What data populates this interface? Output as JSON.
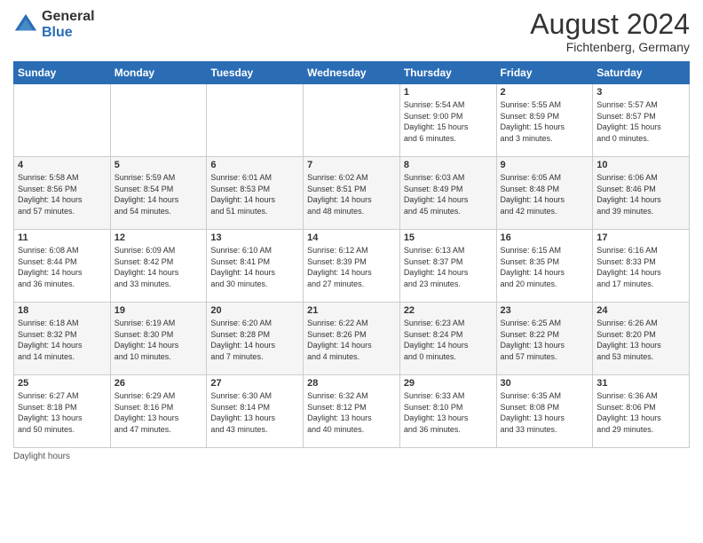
{
  "logo": {
    "general": "General",
    "blue": "Blue"
  },
  "title": {
    "month_year": "August 2024",
    "location": "Fichtenberg, Germany"
  },
  "days_of_week": [
    "Sunday",
    "Monday",
    "Tuesday",
    "Wednesday",
    "Thursday",
    "Friday",
    "Saturday"
  ],
  "weeks": [
    [
      {
        "day": "",
        "info": ""
      },
      {
        "day": "",
        "info": ""
      },
      {
        "day": "",
        "info": ""
      },
      {
        "day": "",
        "info": ""
      },
      {
        "day": "1",
        "info": "Sunrise: 5:54 AM\nSunset: 9:00 PM\nDaylight: 15 hours\nand 6 minutes."
      },
      {
        "day": "2",
        "info": "Sunrise: 5:55 AM\nSunset: 8:59 PM\nDaylight: 15 hours\nand 3 minutes."
      },
      {
        "day": "3",
        "info": "Sunrise: 5:57 AM\nSunset: 8:57 PM\nDaylight: 15 hours\nand 0 minutes."
      }
    ],
    [
      {
        "day": "4",
        "info": "Sunrise: 5:58 AM\nSunset: 8:56 PM\nDaylight: 14 hours\nand 57 minutes."
      },
      {
        "day": "5",
        "info": "Sunrise: 5:59 AM\nSunset: 8:54 PM\nDaylight: 14 hours\nand 54 minutes."
      },
      {
        "day": "6",
        "info": "Sunrise: 6:01 AM\nSunset: 8:53 PM\nDaylight: 14 hours\nand 51 minutes."
      },
      {
        "day": "7",
        "info": "Sunrise: 6:02 AM\nSunset: 8:51 PM\nDaylight: 14 hours\nand 48 minutes."
      },
      {
        "day": "8",
        "info": "Sunrise: 6:03 AM\nSunset: 8:49 PM\nDaylight: 14 hours\nand 45 minutes."
      },
      {
        "day": "9",
        "info": "Sunrise: 6:05 AM\nSunset: 8:48 PM\nDaylight: 14 hours\nand 42 minutes."
      },
      {
        "day": "10",
        "info": "Sunrise: 6:06 AM\nSunset: 8:46 PM\nDaylight: 14 hours\nand 39 minutes."
      }
    ],
    [
      {
        "day": "11",
        "info": "Sunrise: 6:08 AM\nSunset: 8:44 PM\nDaylight: 14 hours\nand 36 minutes."
      },
      {
        "day": "12",
        "info": "Sunrise: 6:09 AM\nSunset: 8:42 PM\nDaylight: 14 hours\nand 33 minutes."
      },
      {
        "day": "13",
        "info": "Sunrise: 6:10 AM\nSunset: 8:41 PM\nDaylight: 14 hours\nand 30 minutes."
      },
      {
        "day": "14",
        "info": "Sunrise: 6:12 AM\nSunset: 8:39 PM\nDaylight: 14 hours\nand 27 minutes."
      },
      {
        "day": "15",
        "info": "Sunrise: 6:13 AM\nSunset: 8:37 PM\nDaylight: 14 hours\nand 23 minutes."
      },
      {
        "day": "16",
        "info": "Sunrise: 6:15 AM\nSunset: 8:35 PM\nDaylight: 14 hours\nand 20 minutes."
      },
      {
        "day": "17",
        "info": "Sunrise: 6:16 AM\nSunset: 8:33 PM\nDaylight: 14 hours\nand 17 minutes."
      }
    ],
    [
      {
        "day": "18",
        "info": "Sunrise: 6:18 AM\nSunset: 8:32 PM\nDaylight: 14 hours\nand 14 minutes."
      },
      {
        "day": "19",
        "info": "Sunrise: 6:19 AM\nSunset: 8:30 PM\nDaylight: 14 hours\nand 10 minutes."
      },
      {
        "day": "20",
        "info": "Sunrise: 6:20 AM\nSunset: 8:28 PM\nDaylight: 14 hours\nand 7 minutes."
      },
      {
        "day": "21",
        "info": "Sunrise: 6:22 AM\nSunset: 8:26 PM\nDaylight: 14 hours\nand 4 minutes."
      },
      {
        "day": "22",
        "info": "Sunrise: 6:23 AM\nSunset: 8:24 PM\nDaylight: 14 hours\nand 0 minutes."
      },
      {
        "day": "23",
        "info": "Sunrise: 6:25 AM\nSunset: 8:22 PM\nDaylight: 13 hours\nand 57 minutes."
      },
      {
        "day": "24",
        "info": "Sunrise: 6:26 AM\nSunset: 8:20 PM\nDaylight: 13 hours\nand 53 minutes."
      }
    ],
    [
      {
        "day": "25",
        "info": "Sunrise: 6:27 AM\nSunset: 8:18 PM\nDaylight: 13 hours\nand 50 minutes."
      },
      {
        "day": "26",
        "info": "Sunrise: 6:29 AM\nSunset: 8:16 PM\nDaylight: 13 hours\nand 47 minutes."
      },
      {
        "day": "27",
        "info": "Sunrise: 6:30 AM\nSunset: 8:14 PM\nDaylight: 13 hours\nand 43 minutes."
      },
      {
        "day": "28",
        "info": "Sunrise: 6:32 AM\nSunset: 8:12 PM\nDaylight: 13 hours\nand 40 minutes."
      },
      {
        "day": "29",
        "info": "Sunrise: 6:33 AM\nSunset: 8:10 PM\nDaylight: 13 hours\nand 36 minutes."
      },
      {
        "day": "30",
        "info": "Sunrise: 6:35 AM\nSunset: 8:08 PM\nDaylight: 13 hours\nand 33 minutes."
      },
      {
        "day": "31",
        "info": "Sunrise: 6:36 AM\nSunset: 8:06 PM\nDaylight: 13 hours\nand 29 minutes."
      }
    ]
  ],
  "footer": {
    "daylight_hours": "Daylight hours"
  }
}
